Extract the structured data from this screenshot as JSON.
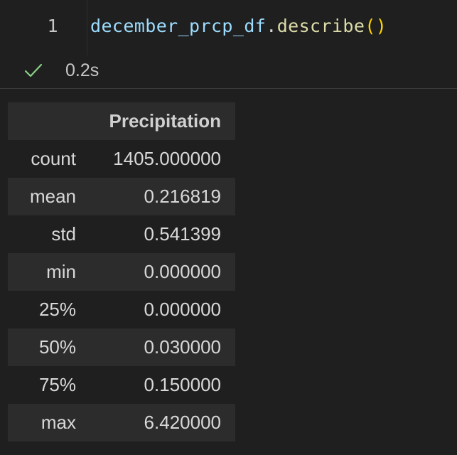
{
  "code_cell": {
    "line_number": "1",
    "tokens": {
      "variable": "december_prcp_df",
      "dot": ".",
      "method": "describe",
      "parens": "()"
    }
  },
  "execution": {
    "status_icon": "check-icon",
    "time": "0.2s",
    "status_color": "#89d185"
  },
  "output_table": {
    "columns": [
      "",
      "Precipitation"
    ],
    "rows": [
      {
        "index": "count",
        "value": "1405.000000"
      },
      {
        "index": "mean",
        "value": "0.216819"
      },
      {
        "index": "std",
        "value": "0.541399"
      },
      {
        "index": "min",
        "value": "0.000000"
      },
      {
        "index": "25%",
        "value": "0.000000"
      },
      {
        "index": "50%",
        "value": "0.030000"
      },
      {
        "index": "75%",
        "value": "0.150000"
      },
      {
        "index": "max",
        "value": "6.420000"
      }
    ]
  },
  "colors": {
    "background": "#1f1f1f",
    "row_stripe": "#2c2c2c",
    "variable": "#9cdcfe",
    "function": "#dcdcaa",
    "bracket": "#ffd700"
  }
}
